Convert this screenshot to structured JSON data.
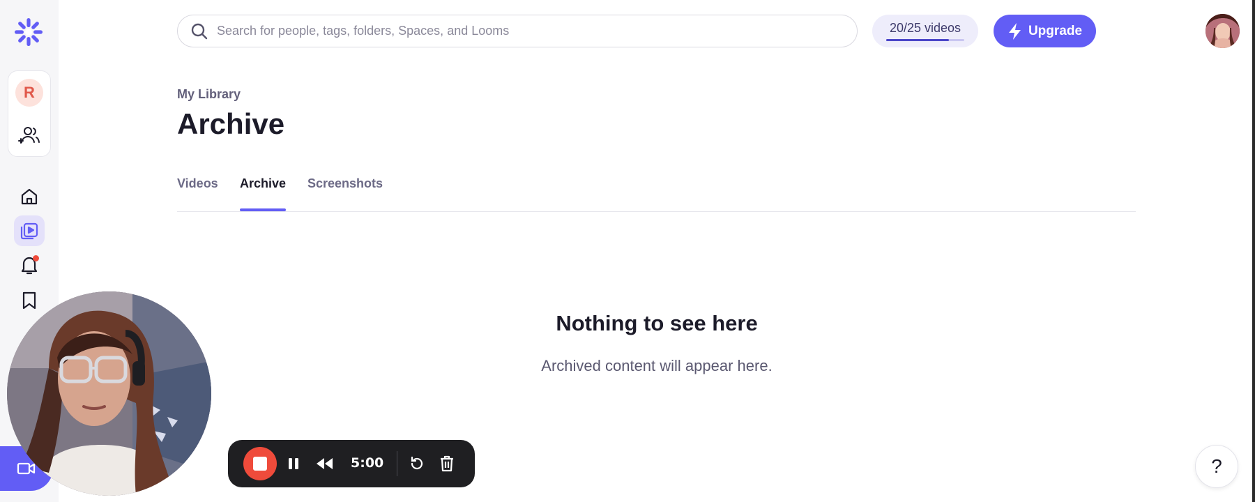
{
  "colors": {
    "brand": "#625df5",
    "record": "#ef4b3b",
    "notification": "#ef4b3b"
  },
  "sidebar": {
    "workspace_initial": "R",
    "icons": [
      "loom-logo-icon",
      "people-icon",
      "home-icon",
      "library-icon",
      "bell-icon",
      "bookmark-icon",
      "record-video-icon"
    ]
  },
  "search": {
    "placeholder": "Search for people, tags, folders, Spaces, and Looms"
  },
  "videos_count": {
    "label": "20/25 videos",
    "used": 20,
    "limit": 25
  },
  "upgrade": {
    "label": "Upgrade"
  },
  "breadcrumb": "My Library",
  "page_title": "Archive",
  "tabs": [
    {
      "label": "Videos",
      "active": false
    },
    {
      "label": "Archive",
      "active": true
    },
    {
      "label": "Screenshots",
      "active": false
    }
  ],
  "empty_state": {
    "title": "Nothing to see here",
    "subtitle": "Archived content will appear here."
  },
  "recording": {
    "time": "5:00"
  },
  "help": {
    "label": "?"
  }
}
